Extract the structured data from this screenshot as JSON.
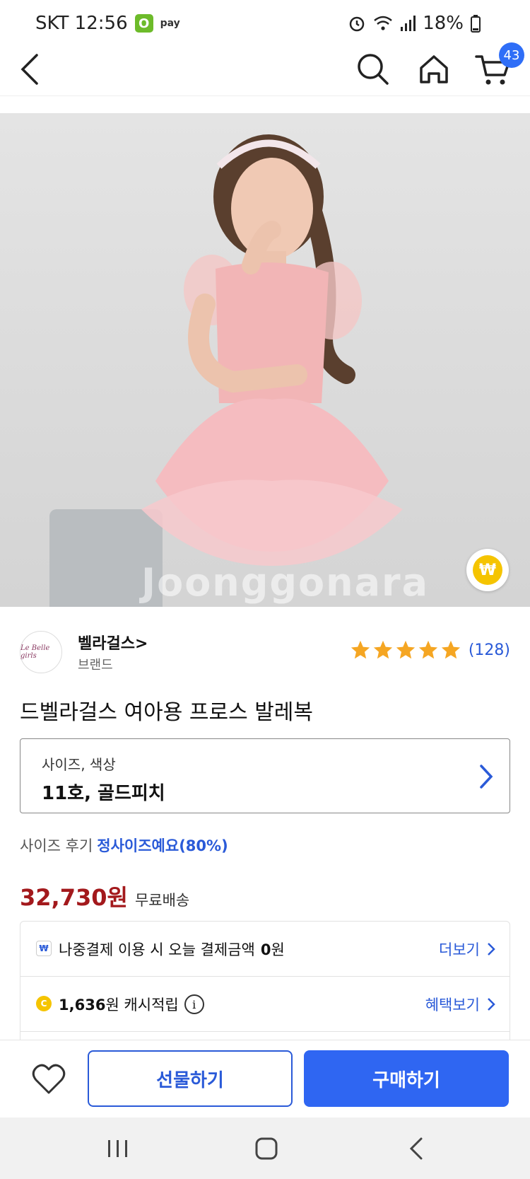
{
  "status_bar": {
    "carrier_time": "SKT 12:56",
    "badge_label": "O",
    "pay_label": "pay",
    "battery": "18%",
    "icons": [
      "alarm-icon",
      "wifi-icon",
      "signal-icon",
      "battery-icon"
    ]
  },
  "nav": {
    "icons": [
      "back-icon",
      "search-icon",
      "home-icon",
      "cart-icon"
    ],
    "cart_count": "43"
  },
  "product_image": {
    "watermark": "Joonggonara",
    "pay_badge": "₩"
  },
  "seller": {
    "name": "벨라걸스>",
    "type": "브랜드",
    "logo_text": "Le Belle girls",
    "rating_stars": 5,
    "review_count": "(128)"
  },
  "product": {
    "title": "드벨라걸스 여아용 프로스 발레복",
    "option_label": "사이즈, 색상",
    "option_value": "11호, 골드피치",
    "size_review_label": "사이즈 후기",
    "size_review_value": "정사이즈예요(80%)",
    "price": "32,730원",
    "shipping": "무료배송"
  },
  "benefits": [
    {
      "icon": "wpay-icon",
      "icon_glyph": "₩",
      "text_prefix": "나중결제 이용 시 오늘 결제금액",
      "text_bold": "0",
      "text_suffix": "원",
      "link": "더보기"
    },
    {
      "icon": "coin-icon",
      "icon_glyph": "C",
      "text_bold": "1,636",
      "text_suffix": "원 캐시적립",
      "info_glyph": "i",
      "link": "혜택보기"
    }
  ],
  "actions": {
    "gift": "선물하기",
    "buy": "구매하기"
  },
  "colors": {
    "accent": "#2f66f2",
    "price": "#a3191c",
    "link": "#2a5ad8",
    "star": "#f5a623"
  }
}
